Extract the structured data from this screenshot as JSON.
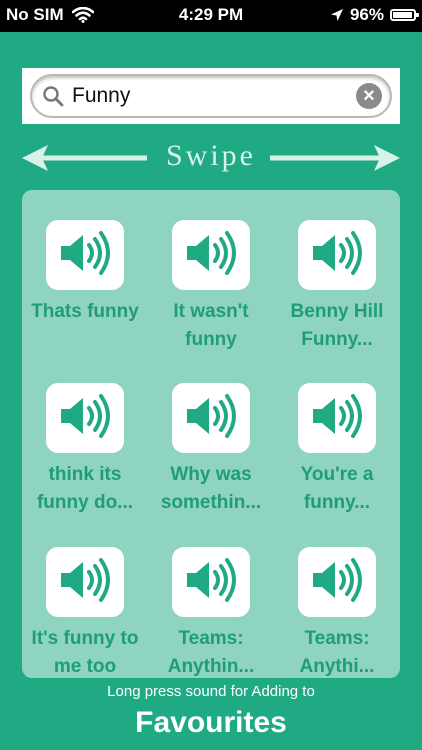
{
  "status_bar": {
    "carrier": "No SIM",
    "time": "4:29 PM",
    "battery": "96%",
    "battery_level": 0.96
  },
  "search": {
    "value": "Funny",
    "placeholder": "Search"
  },
  "swipe": {
    "label": "Swipe"
  },
  "sounds": [
    {
      "label": "Thats funny"
    },
    {
      "label": "It wasn't\nfunny"
    },
    {
      "label": "Benny Hill\nFunny..."
    },
    {
      "label": "think its\nfunny do..."
    },
    {
      "label": "Why was\nsomethin..."
    },
    {
      "label": "You're a\nfunny..."
    },
    {
      "label": "It's funny to\nme too"
    },
    {
      "label": "Teams:\nAnythin..."
    },
    {
      "label": "Teams:\nAnythi..."
    }
  ],
  "footer": {
    "hint": "Long press sound for Adding to",
    "favourites_label": "Favourites"
  },
  "colors": {
    "background": "#1faa84",
    "panel": "#8fd4c1",
    "label": "#1f9d78",
    "speaker_icon": "#1faa84"
  },
  "icons": {
    "speaker": "speaker-icon",
    "search": "search-icon",
    "clear": "clear-icon"
  }
}
